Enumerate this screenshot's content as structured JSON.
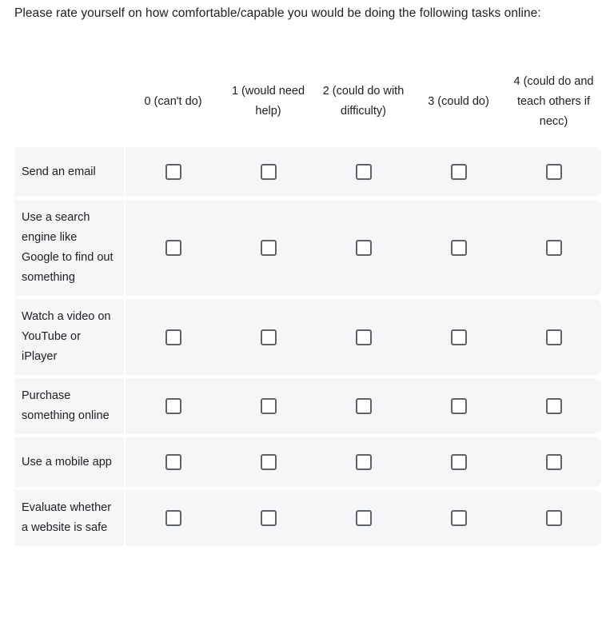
{
  "question": {
    "prompt": "Please rate yourself on how comfortable/capable you would be doing the following tasks online:"
  },
  "grid": {
    "columns": [
      {
        "label": "0 (can't do)"
      },
      {
        "label": "1 (would need help)"
      },
      {
        "label": "2 (could do with difficulty)"
      },
      {
        "label": "3 (could do)"
      },
      {
        "label": "4 (could do and teach others if necc)"
      }
    ],
    "rows": [
      {
        "label": "Send an email"
      },
      {
        "label": "Use a search engine like Google to find out something"
      },
      {
        "label": "Watch a video on YouTube or iPlayer"
      },
      {
        "label": "Purchase something online"
      },
      {
        "label": "Use a mobile app"
      },
      {
        "label": "Evaluate whether a website is safe"
      }
    ],
    "selected": [
      null,
      null,
      null,
      null,
      null,
      null
    ]
  },
  "colors": {
    "text": "#202124",
    "row_background": "#f5f6f8",
    "page_background": "#ffffff",
    "checkbox_border": "#5f6368"
  }
}
